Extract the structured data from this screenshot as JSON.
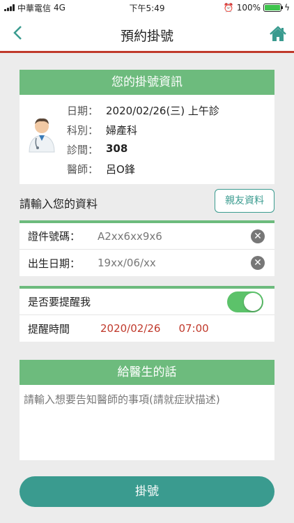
{
  "status_bar": {
    "carrier": "中華電信",
    "network": "4G",
    "time": "下午5:49",
    "battery": "100%"
  },
  "nav": {
    "title": "預約掛號",
    "back_icon": "chevron-left-icon",
    "home_icon": "home-icon",
    "accent": "#3a9b8f",
    "underline_color": "#c0392b"
  },
  "info": {
    "header": "您的掛號資訊",
    "rows": [
      {
        "label": "日期：",
        "value": "2020/02/26(三) 上午診"
      },
      {
        "label": "科別：",
        "value": "婦產科"
      },
      {
        "label": "診間：",
        "value": "308"
      },
      {
        "label": "醫師：",
        "value": "呂O鋒"
      }
    ]
  },
  "form": {
    "title": "請輸入您的資料",
    "friend_button": "親友資料",
    "id_label": "證件號碼：",
    "id_value": "A2xx6xx9x6",
    "birth_label": "出生日期：",
    "birth_value": "19xx/06/xx"
  },
  "remind": {
    "toggle_label": "是否要提醒我",
    "toggle_on": true,
    "time_label": "提醒時間",
    "date": "2020/02/26",
    "time": "07:00"
  },
  "note": {
    "header": "給醫生的話",
    "placeholder": "請輸入想要告知醫師的事項(請就症狀描述)"
  },
  "submit_label": "掛號",
  "colors": {
    "green": "#6dbb7d",
    "teal": "#3a9b8f",
    "red": "#c0392b"
  }
}
